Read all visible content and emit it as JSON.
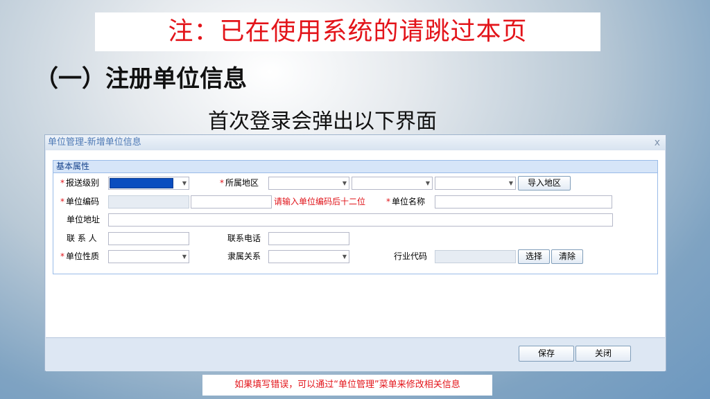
{
  "notice": "注：已在使用系统的请跳过本页",
  "heading": "（一）注册单位信息",
  "subheading": "首次登录会弹出以下界面",
  "dialog": {
    "title": "单位管理-新增单位信息",
    "close": "x",
    "fieldset_title": "基本属性",
    "labels": {
      "report_level": "报送级别",
      "region": "所属地区",
      "unit_code": "单位编码",
      "unit_name": "单位名称",
      "unit_address": "单位地址",
      "contact": "联 系 人",
      "phone": "联系电话",
      "unit_type": "单位性质",
      "affiliation": "隶属关系",
      "industry_code": "行业代码"
    },
    "required_mark": "*",
    "code_hint": "请输入单位编码后十二位",
    "buttons": {
      "import_region": "导入地区",
      "select": "选择",
      "clear": "清除",
      "save": "保存",
      "close": "关闭"
    }
  },
  "tip": "如果填写错误，可以通过“单位管理”菜单来修改相关信息"
}
